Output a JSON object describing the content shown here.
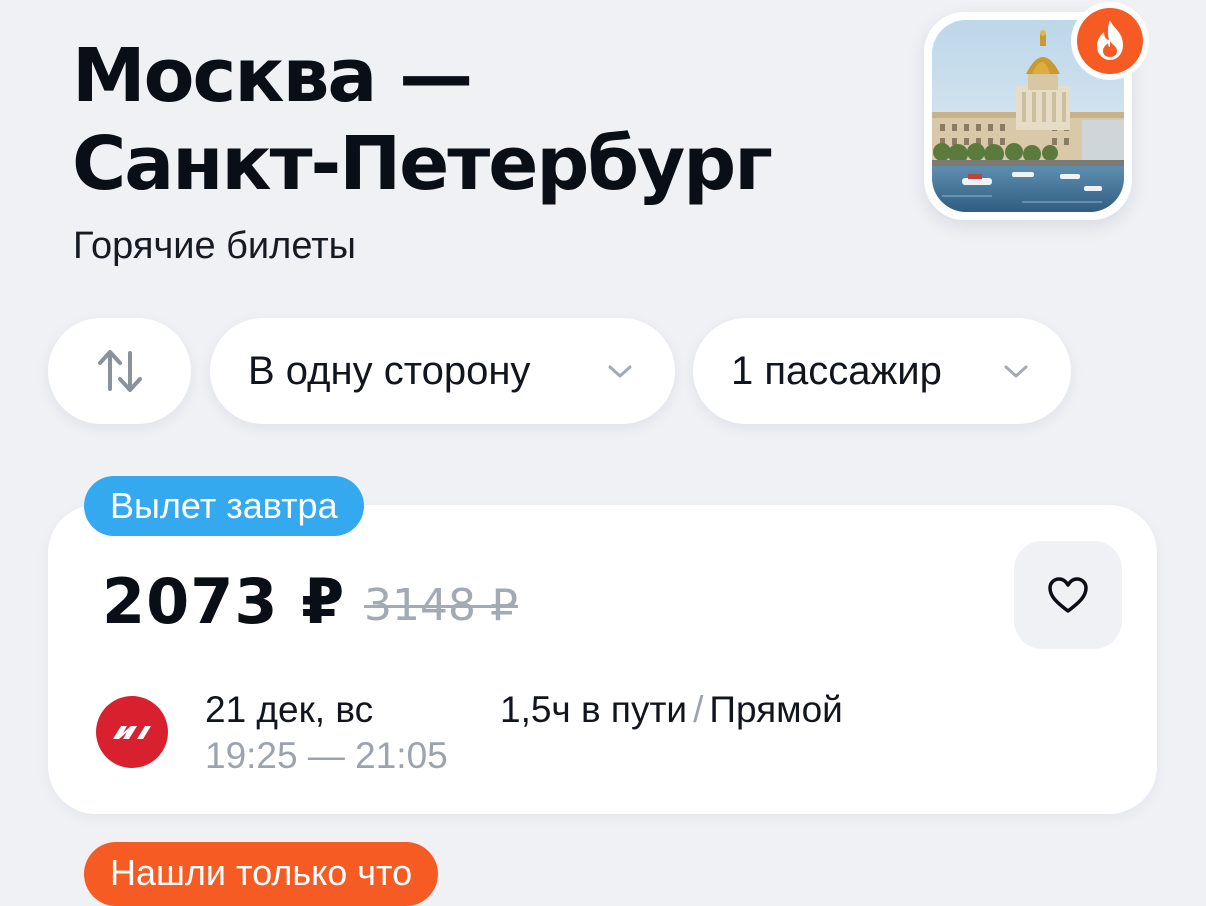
{
  "route": {
    "from_line": "Москва —",
    "to_line": "Санкт-Петербург",
    "subtitle": "Горячие билеты"
  },
  "header_image": {
    "icon": "saint-isaacs-cathedral-photo",
    "badge_icon": "fire-icon"
  },
  "filters": {
    "swap_icon": "swap-arrows-icon",
    "direction_label": "В одну сторону",
    "passengers_label": "1 пассажир"
  },
  "ticket": {
    "tag": "Вылет завтра",
    "price": "2073 ₽",
    "old_price": "3148 ₽",
    "favorite_icon": "heart-icon",
    "airline_icon": "airline-logo",
    "date": "21 дек, вс",
    "time_range": "19:25 — 21:05",
    "duration": "1,5ч в пути",
    "separator": "/",
    "stops": "Прямой"
  },
  "next_ticket": {
    "tag": "Нашли только что"
  },
  "colors": {
    "background": "#eff1f5",
    "tag_blue": "#34a9ef",
    "tag_orange": "#f55b23",
    "airline_red": "#d8202f",
    "muted_text": "#9ca3ad"
  }
}
